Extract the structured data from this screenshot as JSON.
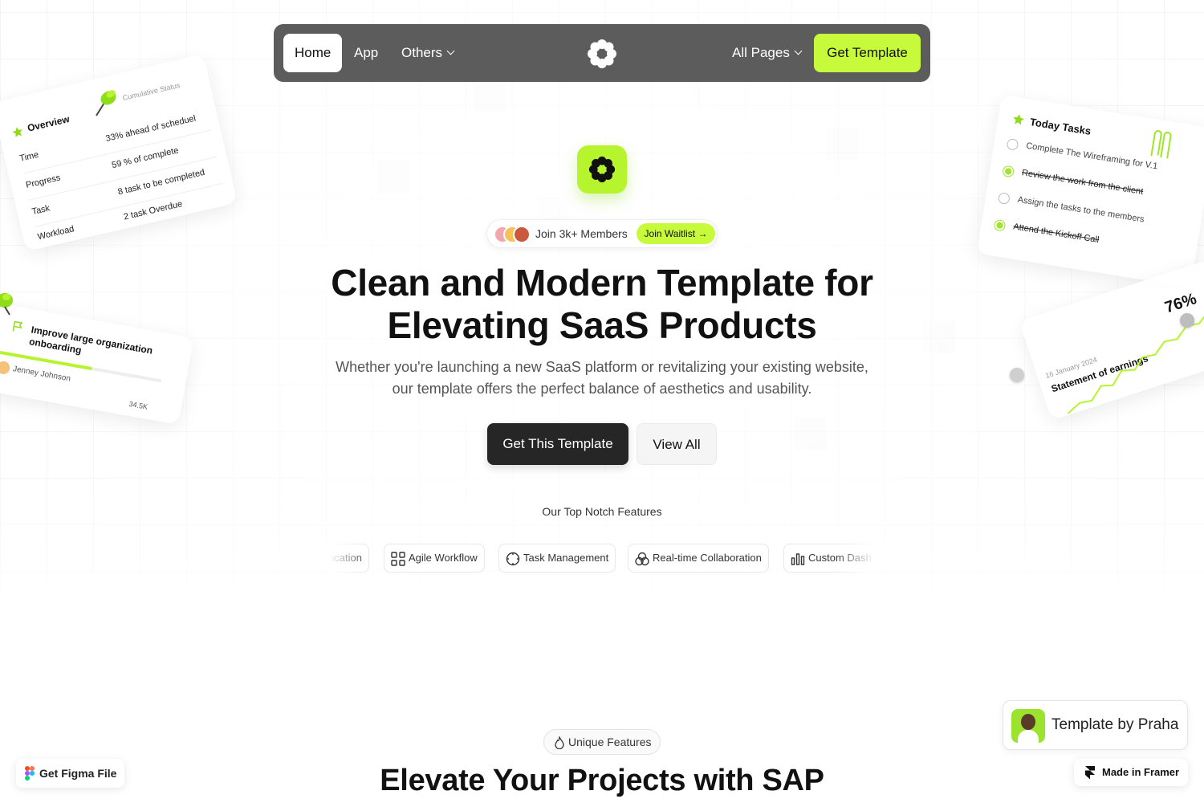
{
  "nav": {
    "home": "Home",
    "app": "App",
    "others": "Others",
    "all_pages": "All Pages",
    "cta": "Get Template"
  },
  "hero": {
    "members_text": "Join 3k+ Members",
    "join_waitlist": "Join Waitlist →",
    "title_line1": "Clean and Modern Template for",
    "title_line2": "Elevating SaaS Products",
    "subtitle_line1": "Whether you're launching a new SaaS platform or revitalizing your existing website,",
    "subtitle_line2": "our template offers the perfect balance of aesthetics and usability.",
    "primary_button": "Get This Template",
    "secondary_button": "View All"
  },
  "features": {
    "label": "Our Top Notch Features",
    "chips": [
      "ocation",
      "Agile Workflow",
      "Task Management",
      "Real-time Collaboration",
      "Custom Dash"
    ]
  },
  "overview_card": {
    "title": "Overview",
    "status": "Cumulative Status",
    "rows": [
      {
        "label": "Time",
        "value": "33% ahead of scheduel"
      },
      {
        "label": "Progress",
        "value": "59 % of complete"
      },
      {
        "label": "Task",
        "value": "8 task to be completed"
      },
      {
        "label": "Workload",
        "value": "2 task Overdue"
      }
    ]
  },
  "onboarding_card": {
    "title": "Improve large organization onboarding",
    "assignee": "Jenney Johnson",
    "value": "34.5K",
    "progress": 0.57
  },
  "tasks_card": {
    "title": "Today Tasks",
    "items": [
      {
        "label": "Complete The Wireframing for V.1",
        "done": false
      },
      {
        "label": "Review the work from the client",
        "done": true
      },
      {
        "label": "Assign the tasks to the members",
        "done": false
      },
      {
        "label": "Attend the Kickoff Call",
        "done": true
      }
    ]
  },
  "earnings_card": {
    "date": "16 January 2024",
    "title": "Statement of earnings",
    "percent": "76%"
  },
  "lower": {
    "badge": "Unique Features",
    "title": "Elevate Your Projects with SAP"
  },
  "floating": {
    "figma": "Get Figma File",
    "praha": "Template by Praha",
    "framer": "Made in Framer"
  },
  "colors": {
    "accent": "#c8fa3c",
    "nav_bg": "#5c5c5c",
    "dark_button": "#262626"
  }
}
